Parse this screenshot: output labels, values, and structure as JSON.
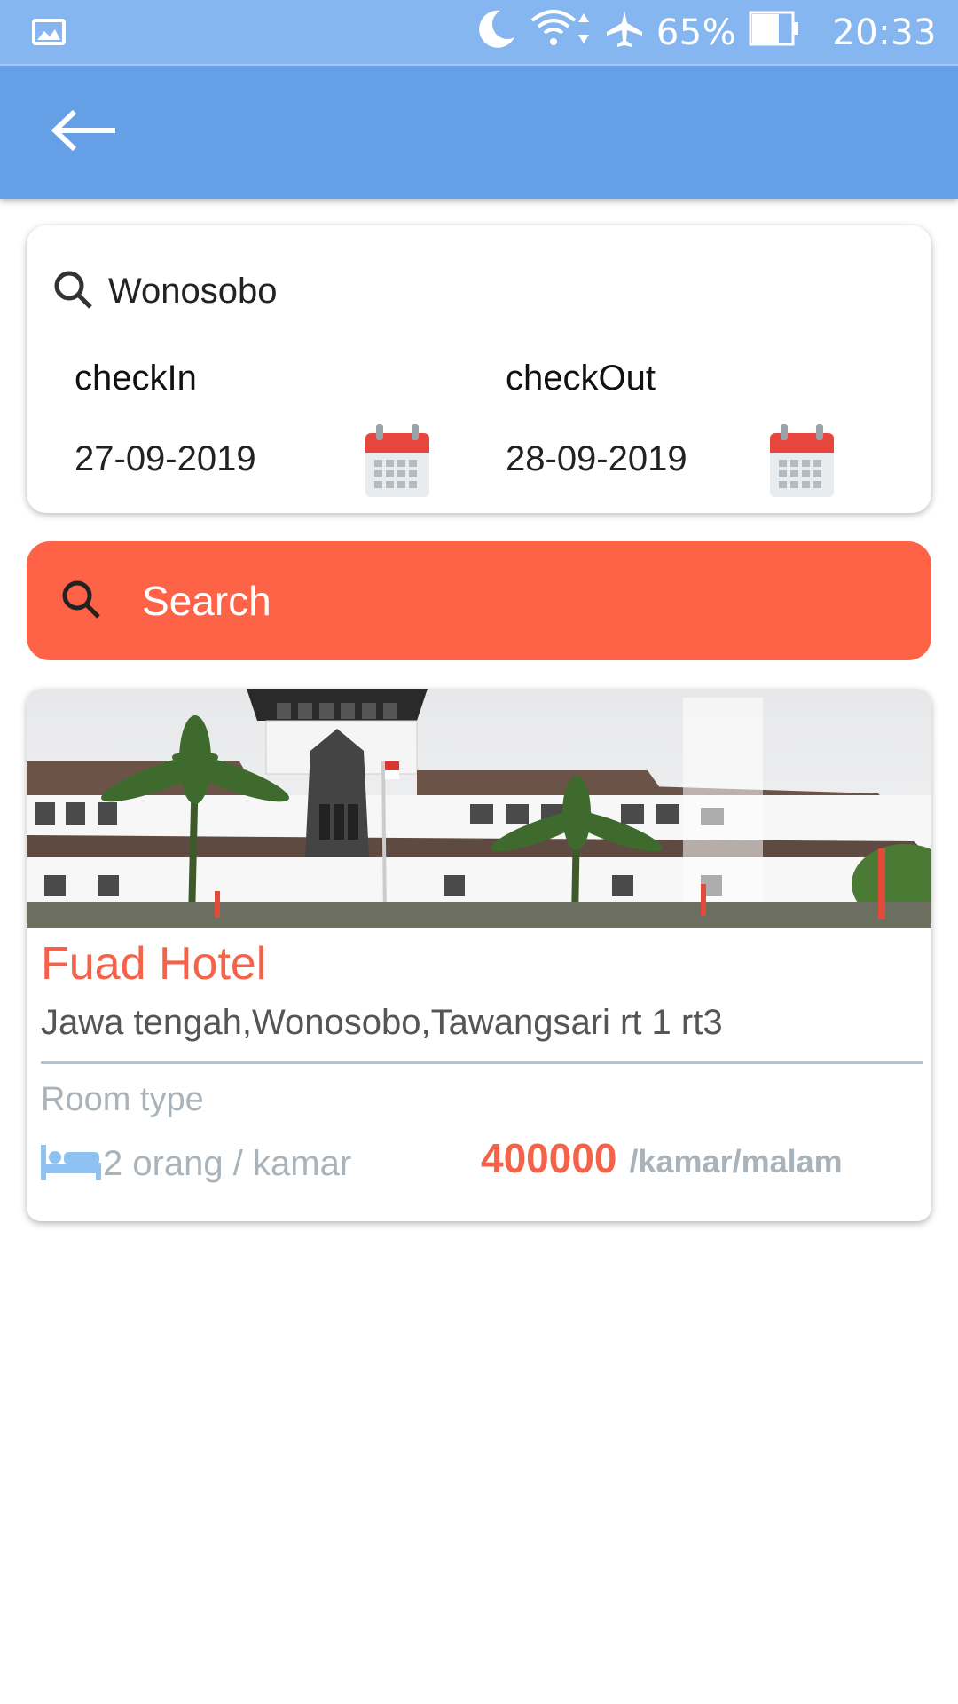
{
  "status_bar": {
    "left_icon": "gallery-icon",
    "battery_percent": "65%",
    "time": "20:33",
    "icons": [
      "moon-icon",
      "wifi-icon",
      "airplane-icon",
      "battery-icon"
    ]
  },
  "app_bar": {
    "back_icon": "arrow-left-icon",
    "color": "#659fe6"
  },
  "search_form": {
    "location": "Wonosobo",
    "checkin": {
      "label": "checkIn",
      "value": "27-09-2019"
    },
    "checkout": {
      "label": "checkOut",
      "value": "28-09-2019"
    },
    "calendar_icon": "calendar-icon"
  },
  "search_button": {
    "label": "Search",
    "color": "#ff6347",
    "icon": "search-icon"
  },
  "hotels": [
    {
      "name": "Fuad Hotel",
      "address": "Jawa tengah,Wonosobo,Tawangsari rt 1 rt3",
      "room_type_label": "Room type",
      "capacity": "2 orang / kamar",
      "price": "400000",
      "price_unit": "/kamar/malam",
      "accent": "#f4624a"
    }
  ]
}
